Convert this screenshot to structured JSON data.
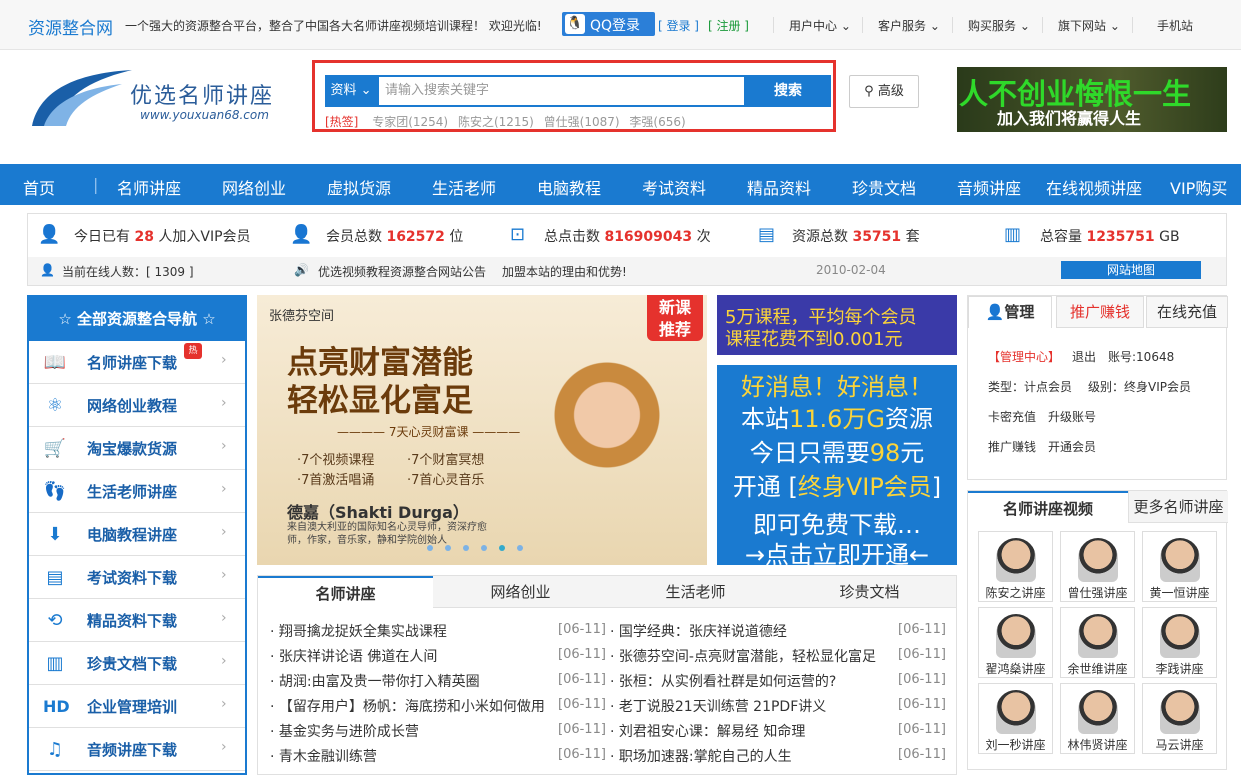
{
  "topbar": {
    "site_name": "资源整合网",
    "slogan": "一个强大的资源整合平台，整合了中国各大名师讲座视频培训课程！ 欢迎光临!",
    "qq_login": "QQ登录",
    "login": "[ 登录 ]",
    "register": "[ 注册 ]",
    "menus": [
      "用户中心 ⌄",
      "客户服务 ⌄",
      "购买服务 ⌄",
      "旗下网站 ⌄",
      "手机站"
    ]
  },
  "logo": {
    "title": "优选名师讲座",
    "url": "www.youxuan68.com"
  },
  "search": {
    "category": "资料 ⌄",
    "placeholder": "请输入搜索关键字",
    "button": "搜索",
    "hot_label": "[热签]",
    "hot_items": [
      "专家团(1254)",
      "陈安之(1215)",
      "曾仕强(1087)",
      "李强(656)"
    ],
    "advanced": "高级"
  },
  "top_banner": {
    "line1": "人不创业悔恨一生",
    "line2": "加入我们将赢得人生"
  },
  "nav": [
    "首页",
    "名师讲座",
    "网络创业",
    "虚拟货源",
    "生活老师",
    "电脑教程",
    "考试资料",
    "精品资料",
    "珍贵文档",
    "音频讲座",
    "在线视频讲座",
    "VIP购买"
  ],
  "stats": [
    {
      "pre": "今日已有 ",
      "num": "28",
      "post": " 人加入VIP会员"
    },
    {
      "pre": "会员总数 ",
      "num": "162572",
      "post": " 位"
    },
    {
      "pre": "总点击数 ",
      "num": "816909043",
      "post": " 次"
    },
    {
      "pre": "资源总数 ",
      "num": "35751",
      "post": " 套"
    },
    {
      "pre": "总容量 ",
      "num": "1235751",
      "post": " GB"
    }
  ],
  "online": "当前在线人数：[ 1309 ]",
  "notice": "优选视频教程资源整合网站公告",
  "notice_link": "加盟本站的理由和优势!",
  "notice_date": "2010-02-04",
  "site_map": "网站地图",
  "sidenav": {
    "title": "☆ 全部资源整合导航 ☆",
    "hot": "热",
    "items": [
      "名师讲座下载",
      "网络创业教程",
      "淘宝爆款货源",
      "生活老师讲座",
      "电脑教程讲座",
      "考试资料下载",
      "精品资料下载",
      "珍贵文档下载",
      "企业管理培训",
      "音频讲座下载"
    ]
  },
  "slide": {
    "brand": "张德芬空间",
    "badge1": "新课",
    "badge2": "推荐",
    "title1": "点亮财富潜能",
    "title2": "轻松显化富足",
    "sub": "———— 7天心灵财富课 ————",
    "points": [
      "·7个视频课程",
      "·7个财富冥想",
      "·7首激活唱诵",
      "·7首心灵音乐"
    ],
    "name": "德嘉（Shakti Durga）",
    "desc": "来自澳大利亚的国际知名心灵导师，资深疗愈师，作家，音乐家，静和学院创始人"
  },
  "ad_small": {
    "line1": "5万课程，平均每个会员",
    "line2": "课程花费不到0.001元"
  },
  "ad_big": {
    "l1": "好消息！好消息！",
    "l2a": "本站",
    "l2b": "11.6万G",
    "l2c": "资源",
    "l3a": "今日只需要",
    "l3b": "98",
    "l3c": "元",
    "l4a": "开通 [",
    "l4b": "终身VIP会员",
    "l4c": "]",
    "l5": "即可免费下载…",
    "l6": "→点击立即开通←"
  },
  "panel": {
    "tabs": [
      "管理",
      "推广赚钱",
      "在线充值"
    ],
    "center": "【管理中心】",
    "logout": "退出",
    "account": "账号:10648",
    "type": "类型：计点会员",
    "level": "级别：终身VIP会员",
    "links1": [
      "卡密充值",
      "升级账号"
    ],
    "links2": [
      "推广赚钱",
      "开通会员"
    ]
  },
  "videos": {
    "tab": "名师讲座视频",
    "more": "更多名师讲座",
    "items": [
      "陈安之讲座",
      "曾仕强讲座",
      "黄一恒讲座",
      "翟鸿燊讲座",
      "余世维讲座",
      "李践讲座",
      "刘一秒讲座",
      "林伟贤讲座",
      "马云讲座"
    ]
  },
  "news": {
    "tabs": [
      "名师讲座",
      "网络创业",
      "生活老师",
      "珍贵文档"
    ],
    "left": [
      {
        "t": "· 翔哥擒龙捉妖全集实战课程",
        "d": "[06-11]"
      },
      {
        "t": "· 张庆祥讲论语 佛道在人间",
        "d": "[06-11]"
      },
      {
        "t": "· 胡润:由富及贵一带你打入精英圈",
        "d": "[06-11]"
      },
      {
        "t": "· 【留存用户】杨帆：海底捞和小米如何做用",
        "d": "[06-11]"
      },
      {
        "t": "· 基金实务与进阶成长营",
        "d": "[06-11]"
      },
      {
        "t": "· 青木金融训练营",
        "d": "[06-11]"
      }
    ],
    "right": [
      {
        "t": "· 国学经典：张庆祥说道德经",
        "d": "[06-11]"
      },
      {
        "t": "· 张德芬空间-点亮财富潜能，轻松显化富足",
        "d": "[06-11]"
      },
      {
        "t": "· 张桓：从实例看社群是如何运营的?",
        "d": "[06-11]"
      },
      {
        "t": "· 老丁说股21天训练营 21PDF讲义",
        "d": "[06-11]"
      },
      {
        "t": "· 刘君祖安心课：解易经 知命理",
        "d": "[06-11]"
      },
      {
        "t": "· 职场加速器:掌舵自己的人生",
        "d": "[06-11]"
      }
    ]
  }
}
